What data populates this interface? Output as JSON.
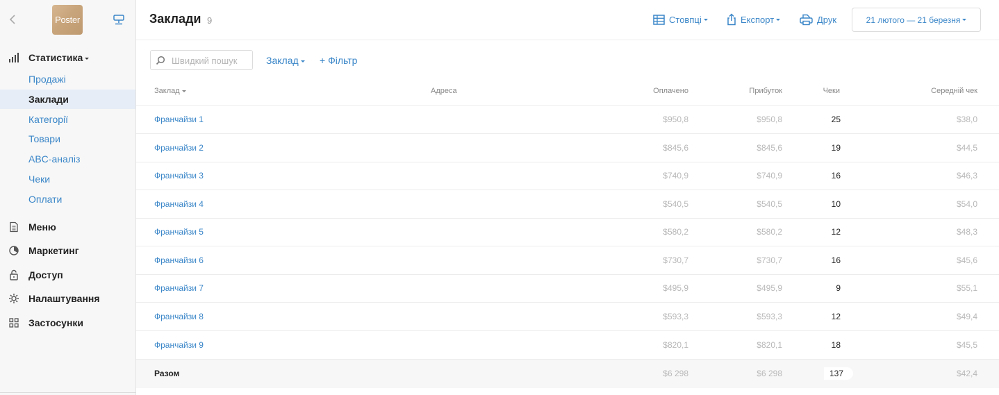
{
  "sidebar": {
    "logo_text_a": "Pos",
    "logo_text_b": "ter",
    "stats": {
      "label": "Статистика",
      "items": [
        {
          "label": "Продажі"
        },
        {
          "label": "Заклади"
        },
        {
          "label": "Категорії"
        },
        {
          "label": "Товари"
        },
        {
          "label": "ABC-аналіз"
        },
        {
          "label": "Чеки"
        },
        {
          "label": "Оплати"
        }
      ]
    },
    "menu_label": "Меню",
    "marketing_label": "Маркетинг",
    "access_label": "Доступ",
    "settings_label": "Налаштування",
    "apps_label": "Застосунки"
  },
  "header": {
    "title": "Заклади",
    "count": "9",
    "columns_label": "Стовпці",
    "export_label": "Експорт",
    "print_label": "Друк",
    "date_range": "21 лютого — 21 березня"
  },
  "filters": {
    "search_placeholder": "Швидкий пошук",
    "venue_label": "Заклад",
    "add_filter_label": "+ Фільтр"
  },
  "table": {
    "headers": {
      "venue": "Заклад",
      "address": "Адреса",
      "paid": "Оплачено",
      "profit": "Прибуток",
      "checks": "Чеки",
      "avg": "Середній чек"
    },
    "rows": [
      {
        "name": "Франчайзи 1",
        "paid": "$950,8",
        "profit": "$950,8",
        "checks": "25",
        "avg": "$38,0"
      },
      {
        "name": "Франчайзи 2",
        "paid": "$845,6",
        "profit": "$845,6",
        "checks": "19",
        "avg": "$44,5"
      },
      {
        "name": "Франчайзи 3",
        "paid": "$740,9",
        "profit": "$740,9",
        "checks": "16",
        "avg": "$46,3"
      },
      {
        "name": "Франчайзи 4",
        "paid": "$540,5",
        "profit": "$540,5",
        "checks": "10",
        "avg": "$54,0"
      },
      {
        "name": "Франчайзи 5",
        "paid": "$580,2",
        "profit": "$580,2",
        "checks": "12",
        "avg": "$48,3"
      },
      {
        "name": "Франчайзи 6",
        "paid": "$730,7",
        "profit": "$730,7",
        "checks": "16",
        "avg": "$45,6"
      },
      {
        "name": "Франчайзи 7",
        "paid": "$495,9",
        "profit": "$495,9",
        "checks": "9",
        "avg": "$55,1"
      },
      {
        "name": "Франчайзи 8",
        "paid": "$593,3",
        "profit": "$593,3",
        "checks": "12",
        "avg": "$49,4"
      },
      {
        "name": "Франчайзи  9",
        "paid": "$820,1",
        "profit": "$820,1",
        "checks": "18",
        "avg": "$45,5"
      }
    ],
    "total": {
      "name": "Разом",
      "paid": "$6 298",
      "profit": "$6 298",
      "checks": "137",
      "avg": "$42,4"
    }
  },
  "colors": {
    "accent": "#3a86c8",
    "muted": "#b8b8b8",
    "sidebar_bg": "#f7f7f7",
    "active_bg": "#e6edf6"
  }
}
